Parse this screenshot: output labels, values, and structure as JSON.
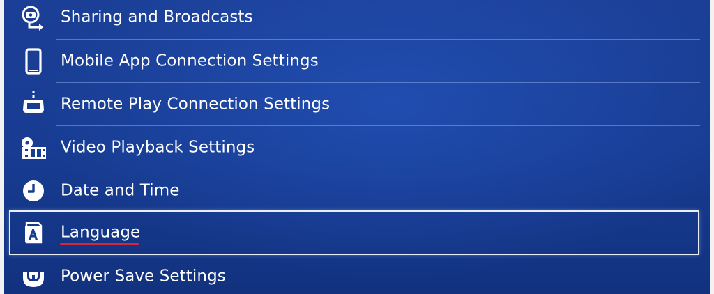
{
  "menu": {
    "items": [
      {
        "label": "Sharing and Broadcasts",
        "icon": "share-broadcast-icon"
      },
      {
        "label": "Mobile App Connection Settings",
        "icon": "mobile-phone-icon"
      },
      {
        "label": "Remote Play Connection Settings",
        "icon": "remote-play-icon"
      },
      {
        "label": "Video Playback Settings",
        "icon": "video-playback-icon"
      },
      {
        "label": "Date and Time",
        "icon": "clock-icon"
      },
      {
        "label": "Language",
        "icon": "language-icon",
        "selected": true
      },
      {
        "label": "Power Save Settings",
        "icon": "power-save-icon"
      }
    ]
  },
  "colors": {
    "background": "#173c92",
    "text": "#ffffff",
    "selection_border": "#e9eef8",
    "annotation_underline": "#d4283a"
  }
}
